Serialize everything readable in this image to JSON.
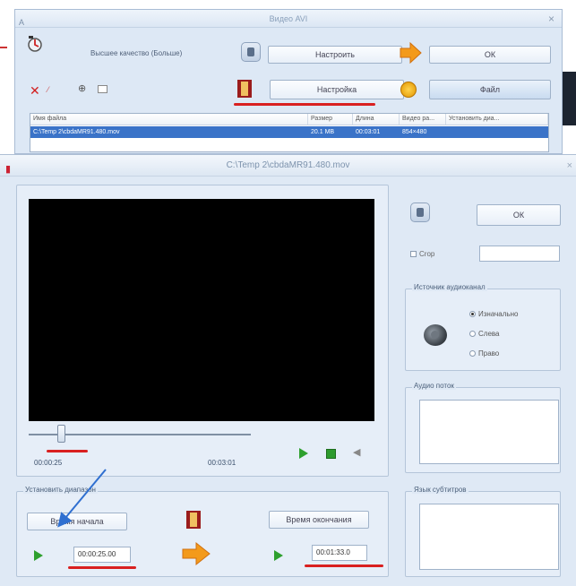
{
  "main_window": {
    "title": "Видео AVI",
    "icon_label": "A",
    "close_glyph": "×",
    "quality_label": "Высшее качество (Больше)",
    "configure_button": "Настроить",
    "ok_button": "ОК",
    "settings_button": "Настройка",
    "file_button": "Файл",
    "file_list": {
      "columns": [
        "Имя файла",
        "Размер",
        "Длина",
        "Видео ра...",
        "Установить диа..."
      ],
      "rows": [
        [
          "C:\\Temp 2\\cbdaMR91.480.mov",
          "20.1 MB",
          "00:03:01",
          "854×480",
          ""
        ]
      ]
    }
  },
  "clip_window": {
    "title": "C:\\Temp 2\\cbdaMR91.480.mov",
    "close_glyph": "×",
    "ok_button": "ОК",
    "crop_label": "Crop",
    "crop_value": "",
    "audio_source_legend": "Источник аудиоканал",
    "audio_options": [
      {
        "label": "Изначально",
        "selected": true
      },
      {
        "label": "Слева",
        "selected": false
      },
      {
        "label": "Право",
        "selected": false
      }
    ],
    "audio_stream_legend": "Аудио поток",
    "subtitle_legend": "Язык субтитров",
    "current_time": "00:00:25",
    "total_time": "00:03:01",
    "range_legend": "Установить диапазон",
    "start_button": "Время начала",
    "end_button": "Время окончания",
    "start_value": "00:00:25.00",
    "end_value": "00:01:33.0"
  }
}
